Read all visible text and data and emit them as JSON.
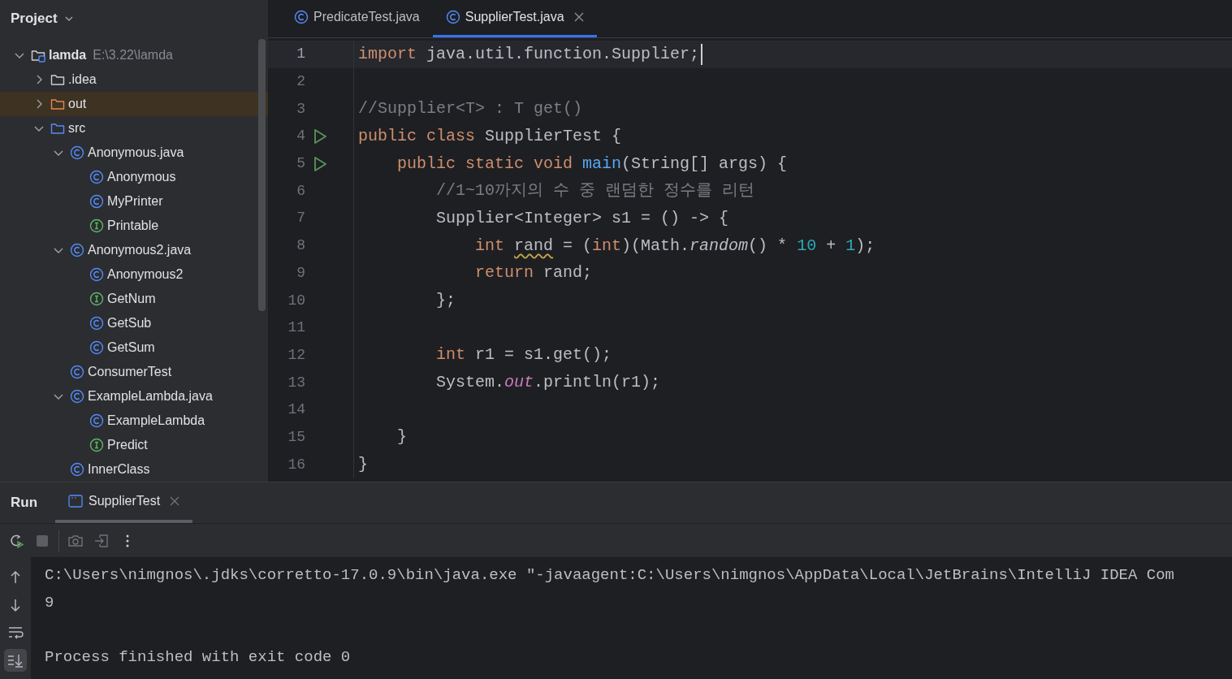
{
  "project_panel": {
    "title": "Project",
    "tree": [
      {
        "label": "lamda",
        "path": "E:\\3.22\\lamda",
        "kind": "module",
        "expanded": true,
        "selected": false,
        "children": [
          {
            "label": ".idea",
            "kind": "folder",
            "expanded": false,
            "selected": false
          },
          {
            "label": "out",
            "kind": "excluded_folder",
            "expanded": false,
            "selected": true
          },
          {
            "label": "src",
            "kind": "source_folder",
            "expanded": true,
            "selected": false,
            "children": [
              {
                "label": "Anonymous.java",
                "kind": "class",
                "expanded": true,
                "selected": false,
                "children": [
                  {
                    "label": "Anonymous",
                    "kind": "class",
                    "selected": false
                  },
                  {
                    "label": "MyPrinter",
                    "kind": "class",
                    "selected": false
                  },
                  {
                    "label": "Printable",
                    "kind": "interface",
                    "selected": false
                  }
                ]
              },
              {
                "label": "Anonymous2.java",
                "kind": "class",
                "expanded": true,
                "selected": false,
                "children": [
                  {
                    "label": "Anonymous2",
                    "kind": "class",
                    "selected": false
                  },
                  {
                    "label": "GetNum",
                    "kind": "interface",
                    "selected": false
                  },
                  {
                    "label": "GetSub",
                    "kind": "class",
                    "selected": false
                  },
                  {
                    "label": "GetSum",
                    "kind": "class",
                    "selected": false
                  }
                ]
              },
              {
                "label": "ConsumerTest",
                "kind": "class",
                "selected": false
              },
              {
                "label": "ExampleLambda.java",
                "kind": "class",
                "expanded": true,
                "selected": false,
                "children": [
                  {
                    "label": "ExampleLambda",
                    "kind": "class",
                    "selected": false
                  },
                  {
                    "label": "Predict",
                    "kind": "interface",
                    "selected": false
                  }
                ]
              },
              {
                "label": "InnerClass",
                "kind": "class",
                "selected": false
              }
            ]
          }
        ]
      }
    ]
  },
  "editor_tabs": [
    {
      "label": "PredicateTest.java",
      "selected": false
    },
    {
      "label": "SupplierTest.java",
      "selected": true
    }
  ],
  "code_lines": [
    {
      "number": "1",
      "current": true,
      "run_marker": false,
      "tokens": [
        {
          "kind": "keyword",
          "text": "import"
        },
        {
          "kind": "plain",
          "text": " java.util.function.Supplier;"
        }
      ]
    },
    {
      "number": "2",
      "current": false,
      "run_marker": false
    },
    {
      "number": "3",
      "current": false,
      "run_marker": false,
      "tokens": [
        {
          "kind": "comment",
          "text": "//Supplier<T> : T get()"
        }
      ]
    },
    {
      "number": "4",
      "current": false,
      "run_marker": true,
      "tokens": [
        {
          "kind": "keyword",
          "text": "public class"
        },
        {
          "kind": "plain",
          "text": " SupplierTest {"
        }
      ]
    },
    {
      "number": "5",
      "current": false,
      "run_marker": true,
      "tokens": [
        {
          "kind": "keyword",
          "text": "    public static void "
        },
        {
          "kind": "method",
          "text": "main"
        },
        {
          "kind": "plain",
          "text": "(String[] args) {"
        }
      ]
    },
    {
      "number": "6",
      "current": false,
      "run_marker": false,
      "tokens": [
        {
          "kind": "comment",
          "text": "        //1~10까지의 수 중 랜덤한 정수를 리턴"
        }
      ]
    },
    {
      "number": "7",
      "current": false,
      "run_marker": false,
      "tokens": [
        {
          "kind": "plain",
          "text": "        Supplier<Integer> s1 = () -> {"
        }
      ]
    },
    {
      "number": "8",
      "current": false,
      "run_marker": false,
      "tokens": [
        {
          "kind": "keyword",
          "text": "            int "
        },
        {
          "kind": "warning",
          "text": "rand"
        },
        {
          "kind": "plain",
          "text": " = ("
        },
        {
          "kind": "keyword",
          "text": "int"
        },
        {
          "kind": "plain",
          "text": ")(Math."
        },
        {
          "kind": "static_method",
          "text": "random"
        },
        {
          "kind": "plain",
          "text": "() * "
        },
        {
          "kind": "number",
          "text": "10"
        },
        {
          "kind": "plain",
          "text": " + "
        },
        {
          "kind": "number",
          "text": "1"
        },
        {
          "kind": "plain",
          "text": ");"
        }
      ]
    },
    {
      "number": "9",
      "current": false,
      "run_marker": false,
      "tokens": [
        {
          "kind": "keyword",
          "text": "            return"
        },
        {
          "kind": "plain",
          "text": " rand;"
        }
      ]
    },
    {
      "number": "10",
      "current": false,
      "run_marker": false,
      "tokens": [
        {
          "kind": "plain",
          "text": "        };"
        }
      ]
    },
    {
      "number": "11",
      "current": false,
      "run_marker": false
    },
    {
      "number": "12",
      "current": false,
      "run_marker": false,
      "tokens": [
        {
          "kind": "keyword",
          "text": "        int"
        },
        {
          "kind": "plain",
          "text": " r1 = s1.get();"
        }
      ]
    },
    {
      "number": "13",
      "current": false,
      "run_marker": false,
      "tokens": [
        {
          "kind": "plain",
          "text": "        System."
        },
        {
          "kind": "static_field",
          "text": "out"
        },
        {
          "kind": "plain",
          "text": ".println(r1);"
        }
      ]
    },
    {
      "number": "14",
      "current": false,
      "run_marker": false
    },
    {
      "number": "15",
      "current": false,
      "run_marker": false,
      "tokens": [
        {
          "kind": "plain",
          "text": "    }"
        }
      ]
    },
    {
      "number": "16",
      "current": false,
      "run_marker": false,
      "tokens": [
        {
          "kind": "plain",
          "text": "}"
        }
      ]
    }
  ],
  "run_panel": {
    "title": "Run",
    "tabs": [
      {
        "label": "SupplierTest",
        "selected": true
      }
    ],
    "scroll_to_end_on": true,
    "console_blocks": [
      [
        "C:\\Users\\nimgnos\\.jdks\\corretto-17.0.9\\bin\\java.exe \"-javaagent:C:\\Users\\nimgnos\\AppData\\Local\\JetBrains\\IntelliJ IDEA Com",
        "9"
      ],
      [
        "Process finished with exit code 0"
      ]
    ]
  }
}
